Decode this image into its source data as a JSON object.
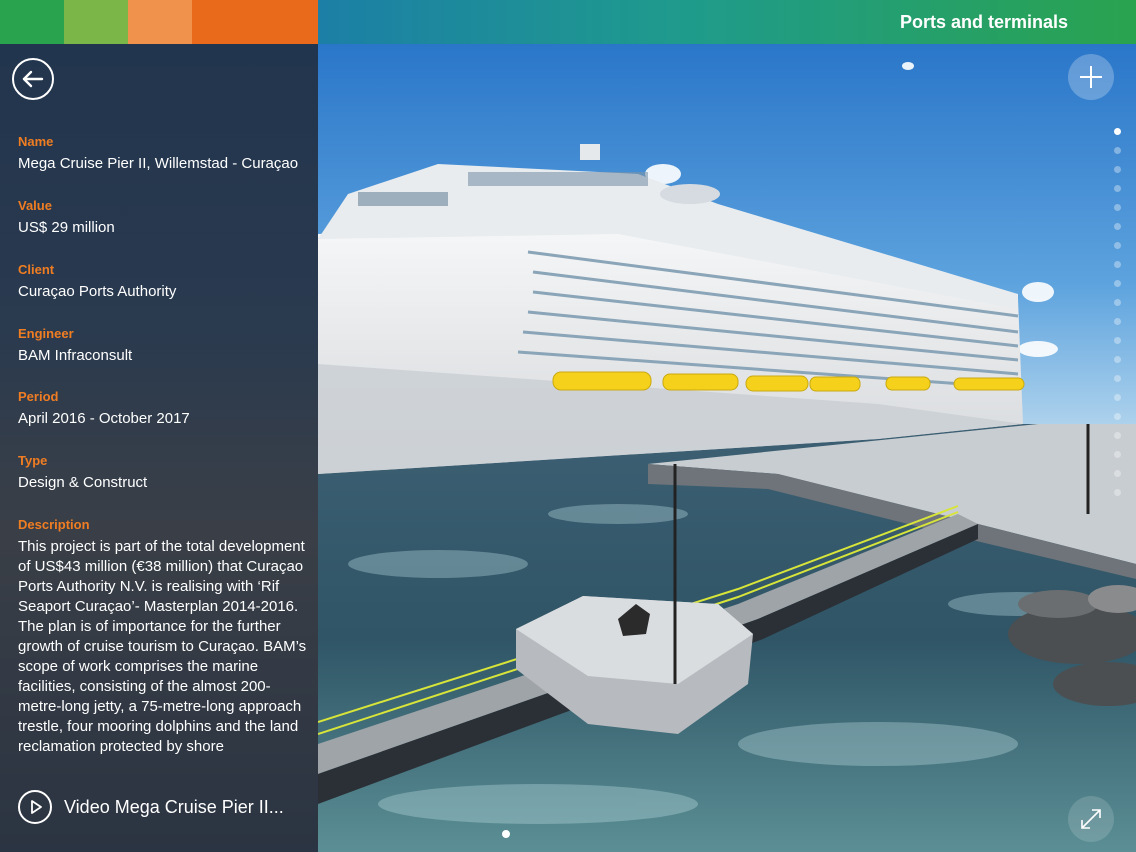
{
  "header": {
    "title": "Ports and terminals"
  },
  "brand_colors": [
    "#2aa34f",
    "#7ab648",
    "#f0914c",
    "#ea6a1c"
  ],
  "project": {
    "name_label": "Name",
    "name": "Mega Cruise Pier II, Willemstad - Curaçao",
    "value_label": "Value",
    "value": "US$ 29 million",
    "client_label": "Client",
    "client": "Curaçao Ports Authority",
    "engineer_label": "Engineer",
    "engineer": "BAM Infraconsult",
    "period_label": "Period",
    "period": "April 2016 - October 2017",
    "type_label": "Type",
    "type": "Design & Construct",
    "description_label": "Description",
    "description": "This project is part of the total development of US$43 million (€38 million) that Curaçao Ports Authority N.V. is realising with ‘Rif Seaport Curaçao’- Masterplan 2014-2016. The plan is of importance for the further growth of cruise tourism to Curaçao. BAM’s scope of work comprises the marine facilities, consisting of the almost 200-metre-long jetty, a 75-metre-long approach trestle, four mooring dolphins and the land reclamation protected by shore"
  },
  "video": {
    "label": "Video Mega Cruise Pier II..."
  },
  "icons": {
    "back": "arrow-left-icon",
    "play": "play-icon",
    "plus": "plus-icon",
    "expand": "expand-icon"
  }
}
